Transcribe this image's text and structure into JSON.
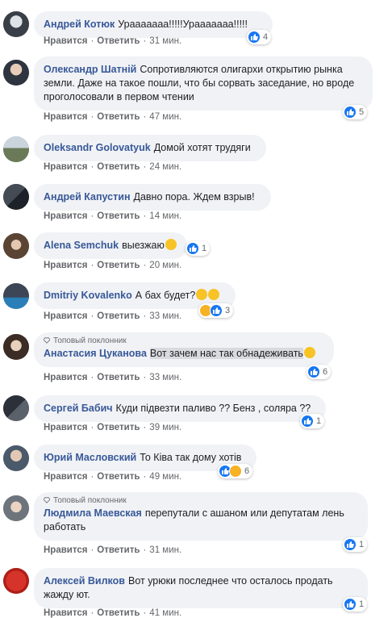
{
  "labels": {
    "like": "Нравится",
    "reply": "Ответить",
    "dot": "·",
    "top_fan": "Топовый поклонник"
  },
  "colors": {
    "author": "#385898",
    "bubble": "#f0f2f5",
    "like_blue": "#1877f2",
    "haha_yellow": "#f7b125"
  },
  "comments": [
    {
      "author": "Андрей Котюк",
      "text": "Урааааааа!!!!!Урааааааа!!!!!",
      "time": "31 мин.",
      "reactions": [
        "like"
      ],
      "reaction_count": "4"
    },
    {
      "author": "Олександр Шатній",
      "text": "Сопротивляются олигархи открытию рынка земли. Даже на такое пошли, что бы сорвать заседание, но вроде проголосовали в первом чтении",
      "time": "47 мин.",
      "reactions": [
        "like"
      ],
      "reaction_count": "5"
    },
    {
      "author": "Oleksandr Golovatyuk",
      "text": "Домой хотят трудяги",
      "time": "24 мин."
    },
    {
      "author": "Андрей Капустин",
      "text": "Давно пора. Ждем взрыв!",
      "time": "14 мин."
    },
    {
      "author": "Alena Semchuk",
      "text": "выезжаю",
      "emoji": [
        "grin-emoji"
      ],
      "time": "20 мин.",
      "reactions": [
        "like"
      ],
      "reaction_count": "1"
    },
    {
      "author": "Dmitriy Kovalenko",
      "text": "А бах будет?",
      "emoji": [
        "upside-down-emoji",
        "grin-emoji"
      ],
      "time": "33 мин.",
      "reactions": [
        "haha",
        "like"
      ],
      "reaction_count": "3"
    },
    {
      "badge": "Топовый поклонник",
      "author": "Анастасия Цуканова",
      "text": "Вот зачем нас так обнадеживать",
      "emoji": [
        "pleading-emoji"
      ],
      "time": "33 мин.",
      "reactions": [
        "like"
      ],
      "reaction_count": "6"
    },
    {
      "author": "Сергей Бабич",
      "text": "Куди підвезти паливо ?? Бенз , соляра ??",
      "time": "39 мин.",
      "reactions": [
        "like"
      ],
      "reaction_count": "1"
    },
    {
      "author": "Юрий Масловский",
      "text": "То Ківа так дому хотів",
      "time": "49 мин.",
      "reactions": [
        "like",
        "haha"
      ],
      "reaction_count": "6"
    },
    {
      "badge": "Топовый поклонник",
      "author": "Людмила Маевская",
      "text": "перепутали с ашаном или депутатам лень работать",
      "time": "31 мин.",
      "reactions": [
        "like"
      ],
      "reaction_count": "1"
    },
    {
      "author": "Алексей Вилков",
      "text": "Вот урюки последнее что осталось продать жажду ют.",
      "time": "41 мин.",
      "reactions": [
        "like"
      ],
      "reaction_count": "1"
    }
  ]
}
